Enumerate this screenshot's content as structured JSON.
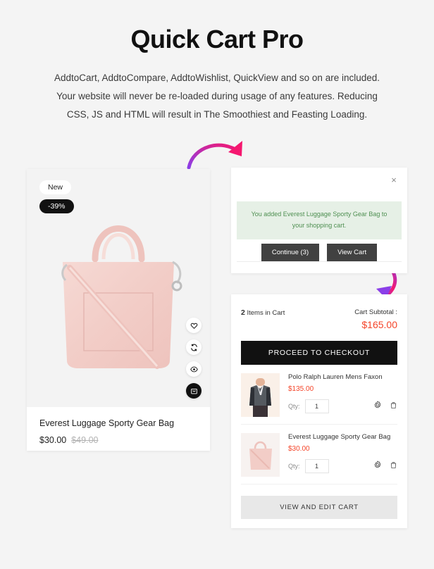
{
  "header": {
    "title": "Quick Cart Pro",
    "subtitle_line1": "AddtoCart, AddtoCompare, AddtoWishlist, QuickView and so on are included.",
    "subtitle_line2": "Your website will never be re-loaded during usage of any features.  Reducing",
    "subtitle_line3": "CSS, JS and HTML will result in The Smoothiest and Feasting Loading."
  },
  "product_card": {
    "badge_new": "New",
    "badge_discount": "-39%",
    "name": "Everest Luggage Sporty Gear Bag",
    "price": "$30.00",
    "price_old": "$49.00",
    "actions": [
      "wishlist-heart-icon",
      "compare-icon",
      "quickview-eye-icon",
      "add-to-cart-bag-icon"
    ]
  },
  "notification": {
    "close_label": "×",
    "message": "You added Everest Luggage Sporty Gear Bag to your shopping cart.",
    "continue_label": "Continue (3)",
    "view_cart_label": "View Cart"
  },
  "cart": {
    "count_number": "2",
    "count_label": "Items in Cart",
    "subtotal_label": "Cart Subtotal :",
    "subtotal_value": "$165.00",
    "checkout_label": "PROCEED TO CHECKOUT",
    "view_edit_label": "VIEW AND EDIT CART",
    "qty_label": "Qty:",
    "items": [
      {
        "name": "Polo Ralph Lauren Mens Faxon",
        "price": "$135.00",
        "qty": "1"
      },
      {
        "name": "Everest Luggage Sporty Gear Bag",
        "price": "$30.00",
        "qty": "1"
      }
    ]
  },
  "colors": {
    "page_bg": "#f4f4f4",
    "accent_price": "#f4452a",
    "success_bg": "#e6f0e6",
    "success_text": "#4e8f51",
    "dark_button": "#111111",
    "gray_button": "#414141",
    "arrow_gradient_start": "#8b3fe8",
    "arrow_gradient_end": "#f5176f"
  }
}
